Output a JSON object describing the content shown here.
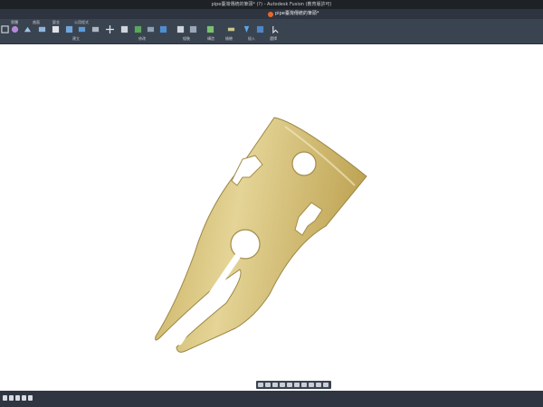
{
  "window": {
    "title": "pipe臺灣傳統的筆頭* (?) - Autodesk Fusion (教育版許可)"
  },
  "document": {
    "tab_title": "pipe臺灣傳統的筆頭*"
  },
  "ribbon": {
    "tabs": [
      "實體",
      "曲面",
      "鈑金",
      "公用程式"
    ],
    "groups": [
      "建立",
      "修改",
      "組裝",
      "構造",
      "檢驗",
      "插入",
      "選擇"
    ]
  },
  "colors": {
    "title_bar": "#1e2227",
    "ribbon": "#3a4350",
    "model_gold": "#d6c27a",
    "canvas": "#ffffff"
  },
  "icons": [
    "select-icon",
    "create-sketch-icon",
    "extrude-icon",
    "fillet-icon",
    "joint-icon",
    "move-icon",
    "measure-icon",
    "insert-icon"
  ]
}
